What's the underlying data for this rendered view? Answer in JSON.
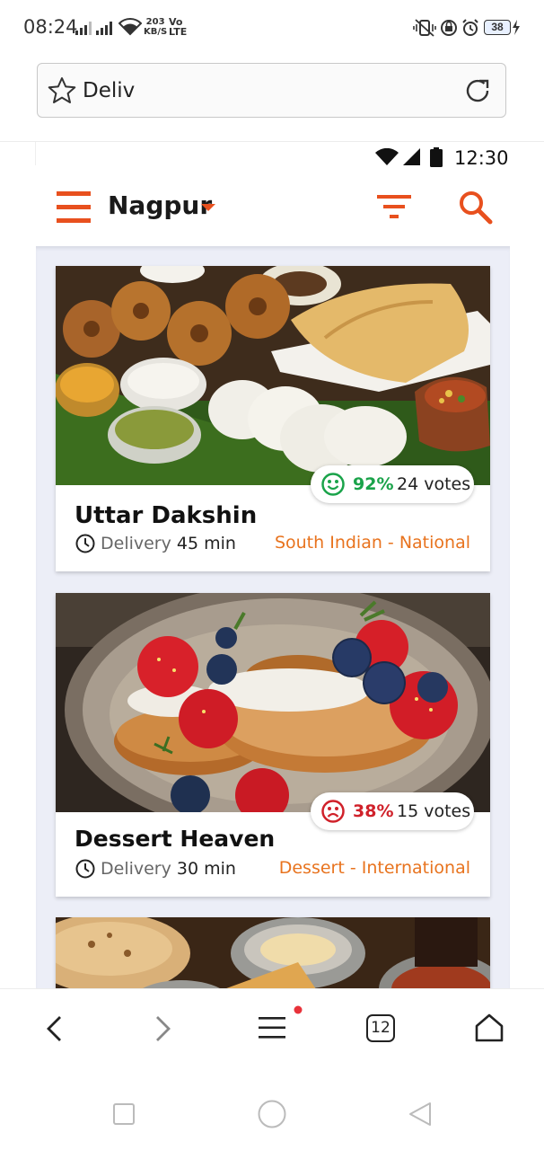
{
  "status_bar": {
    "time": "08:24",
    "net_speed_value": "203",
    "net_speed_unit": "KB/S",
    "volte_top": "Vo",
    "volte_bottom": "LTE",
    "battery": "38"
  },
  "browser": {
    "url_text": "Deliv",
    "tab_count": "12"
  },
  "page": {
    "device_time": "12:30",
    "city": "Nagpur",
    "restaurants": [
      {
        "name": "Uttar Dakshin",
        "delivery_label": "Delivery",
        "delivery_time": "45 min",
        "cuisine": "South Indian - National",
        "rating_pct": "92%",
        "votes": "24 votes",
        "sentiment": "positive",
        "rating_color": "#1aa34a"
      },
      {
        "name": "Dessert Heaven",
        "delivery_label": "Delivery",
        "delivery_time": "30 min",
        "cuisine": "Dessert - International",
        "rating_pct": "38%",
        "votes": "15 votes",
        "sentiment": "negative",
        "rating_color": "#d0212a"
      }
    ]
  },
  "colors": {
    "accent": "#e8501e",
    "cuisine": "#e8731e",
    "feed_bg": "#eceef7"
  },
  "icons": [
    "star-icon",
    "reload-icon",
    "hamburger-menu-icon",
    "dropdown-caret-icon",
    "filter-icon",
    "search-icon",
    "clock-icon",
    "smile-icon",
    "frown-icon",
    "back-icon",
    "forward-icon",
    "browser-menu-icon",
    "tabs-icon",
    "home-icon",
    "recents-icon",
    "home-circle-icon",
    "back-triangle-icon"
  ]
}
